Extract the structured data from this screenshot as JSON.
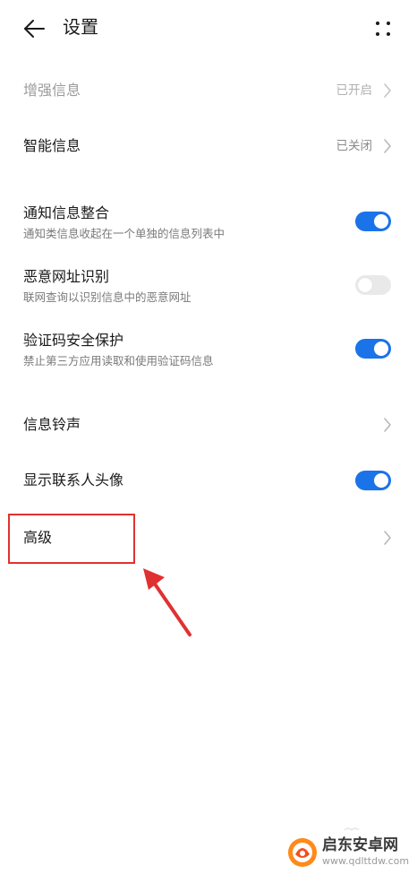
{
  "header": {
    "title": "设置"
  },
  "settings": {
    "enhanced_info": {
      "title": "增强信息",
      "value": "已开启"
    },
    "smart_info": {
      "title": "智能信息",
      "value": "已关闭"
    },
    "notification_merge": {
      "title": "通知信息整合",
      "subtitle": "通知类信息收起在一个单独的信息列表中",
      "enabled": true
    },
    "malicious_url": {
      "title": "恶意网址识别",
      "subtitle": "联网查询以识别信息中的恶意网址",
      "enabled": false
    },
    "verification_code": {
      "title": "验证码安全保护",
      "subtitle": "禁止第三方应用读取和使用验证码信息",
      "enabled": true
    },
    "ringtone": {
      "title": "信息铃声"
    },
    "show_avatar": {
      "title": "显示联系人头像",
      "enabled": true
    },
    "advanced": {
      "title": "高级"
    }
  },
  "colors": {
    "accent": "#1a73e8",
    "annotation": "#e03131",
    "toggle_off": "#e9e9e9"
  },
  "watermark": {
    "name": "启东安卓网",
    "url": "www.qdlttdw.com"
  }
}
